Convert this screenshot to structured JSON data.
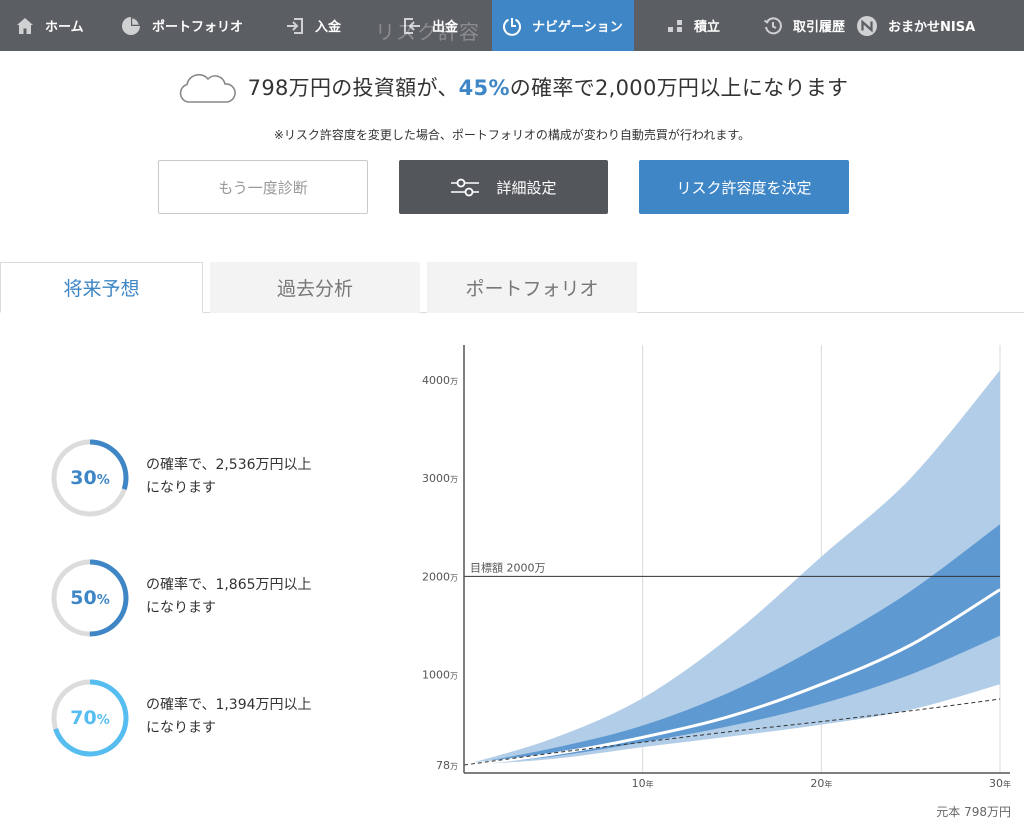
{
  "nav": {
    "items": [
      {
        "label": "ホーム",
        "icon": "home-icon"
      },
      {
        "label": "ポートフォリオ",
        "icon": "pie-chart-icon"
      },
      {
        "label": "入金",
        "icon": "deposit-icon"
      },
      {
        "label": "出金",
        "icon": "withdraw-icon"
      },
      {
        "label": "ナビゲーション",
        "icon": "navigation-icon",
        "active": true
      },
      {
        "label": "積立",
        "icon": "accumulation-icon"
      },
      {
        "label": "取引履歴",
        "icon": "history-icon"
      },
      {
        "label": "おまかせNISA",
        "icon": "nisa-icon"
      }
    ],
    "ghost_title": "リスク許容"
  },
  "headline": {
    "prefix": "798万円の投資額が、",
    "percent": "45%",
    "suffix": "の確率で2,000万円以上になります",
    "icon": "cloud-icon"
  },
  "notice": "※リスク許容度を変更した場合、ポートフォリオの構成が変わり自動売買が行われます。",
  "buttons": {
    "rediagnose": "もう一度診断",
    "detail": "詳細設定",
    "decide": "リスク許容度を決定"
  },
  "tabs": [
    {
      "label": "将来予想",
      "active": true
    },
    {
      "label": "過去分析"
    },
    {
      "label": "ポートフォリオ"
    }
  ],
  "probabilities": [
    {
      "percent": 30,
      "num": "30",
      "unit": "%",
      "line1": "の確率で、2,536万円以上",
      "line2": "になります",
      "color": "#3e86c5"
    },
    {
      "percent": 50,
      "num": "50",
      "unit": "%",
      "line1": "の確率で、1,865万円以上",
      "line2": "になります",
      "color": "#3e86c5"
    },
    {
      "percent": 70,
      "num": "70",
      "unit": "%",
      "line1": "の確率で、1,394万円以上",
      "line2": "になります",
      "color": "#56bdf0"
    }
  ],
  "colors": {
    "accent": "#3e86c5",
    "nav_bg": "#5b5e62",
    "band_outer": "#b1cde7",
    "band_inner": "#5f99d2",
    "ring_track": "#dcdcdc"
  },
  "chart_data": {
    "type": "area",
    "x_range": [
      0,
      30
    ],
    "y_range": [
      0,
      4200
    ],
    "y_ticks": [
      {
        "value": 78,
        "label": "78",
        "unit": "万"
      },
      {
        "value": 1000,
        "label": "1000",
        "unit": "万"
      },
      {
        "value": 2000,
        "label": "2000",
        "unit": "万"
      },
      {
        "value": 3000,
        "label": "3000",
        "unit": "万"
      },
      {
        "value": 4000,
        "label": "4000",
        "unit": "万"
      }
    ],
    "x_ticks": [
      {
        "value": 10,
        "label": "10",
        "unit": "年"
      },
      {
        "value": 20,
        "label": "20",
        "unit": "年"
      },
      {
        "value": 30,
        "label": "30",
        "unit": "年"
      }
    ],
    "target": {
      "value": 2000,
      "label": "目標額 2000万"
    },
    "x": [
      0,
      5,
      10,
      15,
      20,
      25,
      30
    ],
    "outer_upper": [
      78,
      350,
      760,
      1400,
      2200,
      3000,
      4100
    ],
    "inner_upper": [
      78,
      250,
      480,
      830,
      1300,
      1850,
      2530
    ],
    "median": [
      78,
      190,
      360,
      580,
      900,
      1300,
      1865
    ],
    "inner_lower": [
      78,
      165,
      310,
      480,
      700,
      1000,
      1394
    ],
    "outer_lower": [
      78,
      140,
      260,
      370,
      490,
      640,
      900
    ],
    "principal": [
      78,
      200,
      310,
      420,
      520,
      630,
      750
    ],
    "caption": "元本 798万円"
  }
}
